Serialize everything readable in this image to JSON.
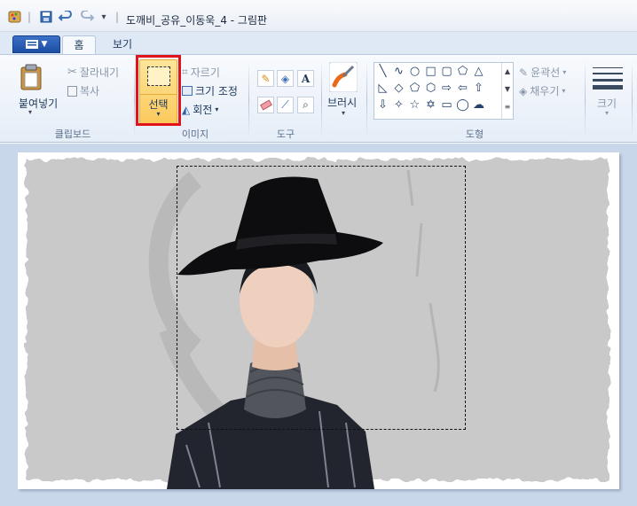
{
  "window": {
    "title": "도깨비_공유_이동욱_4 - 그림판",
    "separator": "|"
  },
  "tabs": {
    "home": "홈",
    "view": "보기"
  },
  "ribbon": {
    "clipboard": {
      "paste": "붙여넣기",
      "cut": "잘라내기",
      "copy": "복사",
      "label": "클립보드"
    },
    "image": {
      "select": "선택",
      "crop": "자르기",
      "resize": "크기 조정",
      "rotate": "회전",
      "label": "이미지"
    },
    "tools": {
      "text_tool": "A",
      "label": "도구"
    },
    "brushes": {
      "label": "브러시"
    },
    "shapes": {
      "outline": "윤곽선",
      "fill": "채우기",
      "label": "도형"
    },
    "size": {
      "label": "크기"
    }
  },
  "colors": {
    "ribbon_bg": "#e5edf7",
    "canvas_bg": "#c9d7ea",
    "highlight": "#e0141b",
    "select_button": "#fcd67a"
  }
}
